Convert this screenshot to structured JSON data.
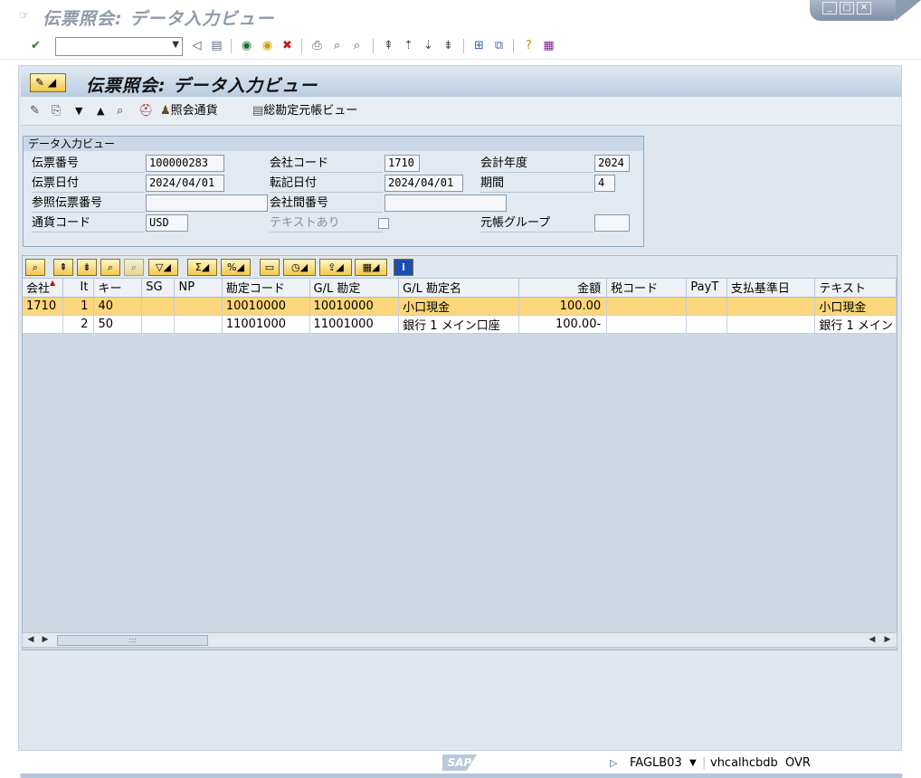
{
  "window": {
    "title": "伝票照会: データ入力ビュー",
    "controls": [
      "minimize-icon",
      "maximize-icon",
      "close-icon"
    ]
  },
  "system_toolbar": {
    "command_field_value": "",
    "icons": [
      "enter-icon",
      "back-icon",
      "save-icon",
      "back-nav-icon",
      "exit-icon",
      "cancel-icon",
      "print-icon",
      "find-icon",
      "find-next-icon",
      "first-page-icon",
      "prev-page-icon",
      "next-page-icon",
      "last-page-icon",
      "new-session-icon",
      "shortcut-icon",
      "help-icon",
      "layout-icon"
    ]
  },
  "header": {
    "title": "伝票照会: データ入力ビュー"
  },
  "app_toolbar": {
    "currency_label": "照会通貨",
    "ledger_view_label": "総勘定元帳ビュー"
  },
  "data_entry": {
    "group_title": "データ入力ビュー",
    "doc_number_label": "伝票番号",
    "doc_number": "100000283",
    "company_code_label": "会社コード",
    "company_code": "1710",
    "fiscal_year_label": "会計年度",
    "fiscal_year": "2024",
    "doc_date_label": "伝票日付",
    "doc_date": "2024/04/01",
    "posting_date_label": "転記日付",
    "posting_date": "2024/04/01",
    "period_label": "期間",
    "period": "4",
    "reference_label": "参照伝票番号",
    "reference": "",
    "cross_company_label": "会社間番号",
    "cross_company": "",
    "currency_label": "通貨コード",
    "currency": "USD",
    "text_exists_label": "テキストあり",
    "ledger_group_label": "元帳グループ",
    "ledger_group": ""
  },
  "grid": {
    "columns": [
      "会社",
      "It",
      "キー",
      "SG",
      "NP",
      "勘定コード",
      "G/L 勘定",
      "G/L 勘定名",
      "金額",
      "税コード",
      "PayT",
      "支払基準日",
      "テキスト"
    ],
    "rows": [
      [
        "1710",
        "1",
        "40",
        "",
        "",
        "10010000",
        "10010000",
        "小口現金",
        "100.00",
        "",
        "",
        "",
        "小口現金"
      ],
      [
        "",
        "2",
        "50",
        "",
        "",
        "11001000",
        "11001000",
        "銀行 1 メイン口座",
        "100.00-",
        "",
        "",
        "",
        "銀行 1 メイン"
      ]
    ]
  },
  "status_bar": {
    "logo": "SAP",
    "transaction": "FAGLB03",
    "server": "vhcalhcbdb",
    "client": "OVR"
  }
}
